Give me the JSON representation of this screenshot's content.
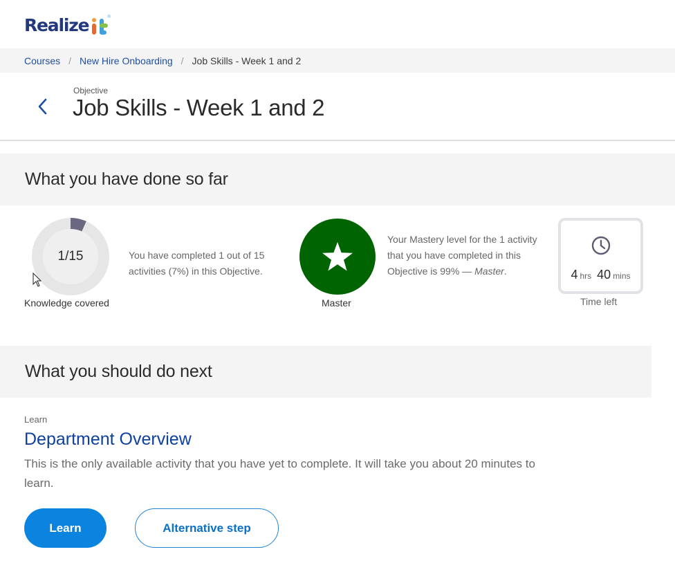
{
  "brand": {
    "name": "Realize",
    "suffix": "it",
    "registered": "®"
  },
  "breadcrumb": {
    "items": [
      {
        "label": "Courses",
        "link": true
      },
      {
        "label": "New Hire Onboarding",
        "link": true
      },
      {
        "label": "Job Skills - Week 1 and 2",
        "link": false
      }
    ],
    "separator": "/"
  },
  "header": {
    "back_icon": "chevron-left-icon",
    "eyebrow": "Objective",
    "title": "Job Skills - Week 1 and 2"
  },
  "progress_section": {
    "heading": "What you have done so far",
    "knowledge": {
      "completed": 1,
      "total": 15,
      "display": "1/15",
      "fraction": 0.0667,
      "caption": "Knowledge covered",
      "description": "You have completed 1 out of 15 activities (7%) in this Objective."
    },
    "mastery": {
      "icon": "star-icon",
      "level_label": "Master",
      "caption": "Master",
      "description_prefix": "Your Mastery level for the 1 activity that you have completed in this Objective is 99% — ",
      "description_level": "Master",
      "description_suffix": ".",
      "percent": 99
    },
    "time_left": {
      "icon": "clock-icon",
      "hours": "4",
      "hours_unit": "hrs",
      "minutes": "40",
      "minutes_unit": "mins",
      "caption": "Time left"
    }
  },
  "next_section": {
    "heading": "What you should do next",
    "activity_type": "Learn",
    "activity_title": "Department Overview",
    "description": "This is the only available activity that you have yet to complete.  It will take you about 20 minutes to learn.",
    "primary_button": "Learn",
    "secondary_button": "Alternative step"
  },
  "colors": {
    "brand_navy": "#23397e",
    "link_blue": "#1f4e9e",
    "mastery_green": "#006400",
    "primary_button": "#0a84df",
    "ring_progress": "#6a6880",
    "ring_track": "#e6e6e6"
  }
}
